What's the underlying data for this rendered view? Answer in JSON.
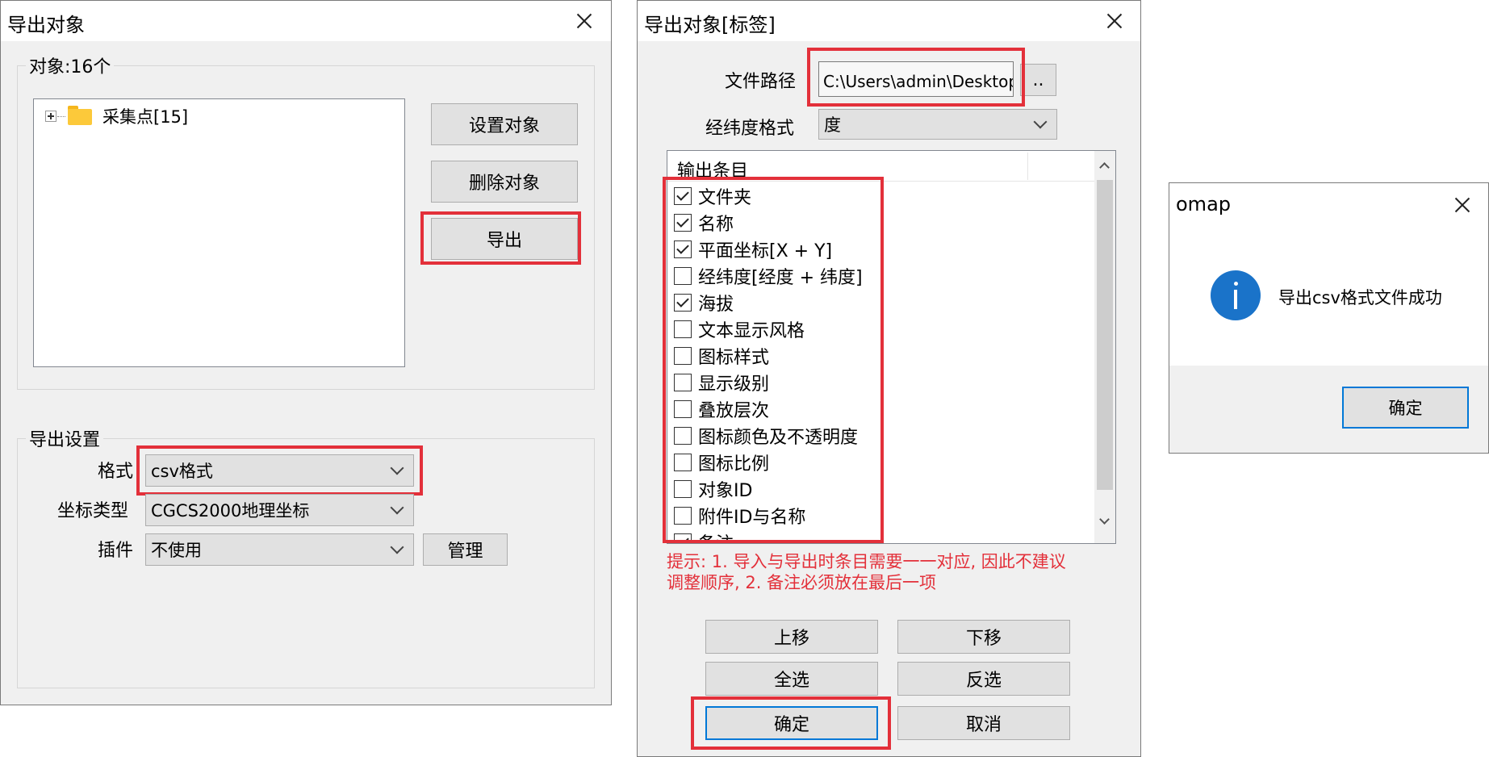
{
  "dialog1": {
    "title": "导出对象",
    "objects_group": "对象:16个",
    "tree_item": "采集点[15]",
    "btn_set": "设置对象",
    "btn_delete": "删除对象",
    "btn_export": "导出",
    "settings_group": "导出设置",
    "format_label": "格式",
    "format_value": "csv格式",
    "coord_label": "坐标类型",
    "coord_value": "CGCS2000地理坐标",
    "plugin_label": "插件",
    "plugin_value": "不使用",
    "btn_manage": "管理"
  },
  "dialog2": {
    "title": "导出对象[标签]",
    "path_label": "文件路径",
    "path_value": "C:\\Users\\admin\\Desktop\\采集",
    "browse": "..",
    "latlon_label": "经纬度格式",
    "latlon_value": "度",
    "list_header": "输出条目",
    "items": [
      {
        "label": "文件夹",
        "checked": true
      },
      {
        "label": "名称",
        "checked": true
      },
      {
        "label": "平面坐标[X + Y]",
        "checked": true
      },
      {
        "label": "经纬度[经度 + 纬度]",
        "checked": false
      },
      {
        "label": "海拔",
        "checked": true
      },
      {
        "label": "文本显示风格",
        "checked": false
      },
      {
        "label": "图标样式",
        "checked": false
      },
      {
        "label": "显示级别",
        "checked": false
      },
      {
        "label": "叠放层次",
        "checked": false
      },
      {
        "label": "图标颜色及不透明度",
        "checked": false
      },
      {
        "label": "图标比例",
        "checked": false
      },
      {
        "label": "对象ID",
        "checked": false
      },
      {
        "label": "附件ID与名称",
        "checked": false
      },
      {
        "label": "备注",
        "checked": true
      }
    ],
    "hint_line1": "提示: 1. 导入与导出时条目需要一一对应, 因此不建议",
    "hint_line2": "调整顺序, 2. 备注必须放在最后一项",
    "hint_color": "#e3303a",
    "btn_up": "上移",
    "btn_down": "下移",
    "btn_all": "全选",
    "btn_invert": "反选",
    "btn_ok": "确定",
    "btn_cancel": "取消"
  },
  "dialog3": {
    "title": "omap",
    "message": "导出csv格式文件成功",
    "info_icon_color": "#1a73c9",
    "btn_ok": "确定"
  },
  "highlight_color": "#e3303a"
}
